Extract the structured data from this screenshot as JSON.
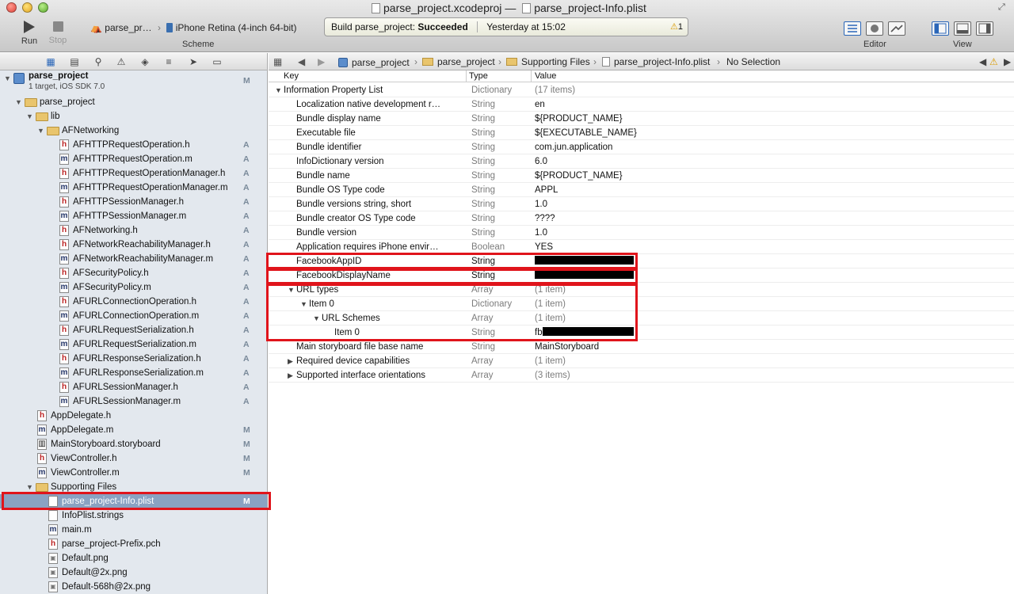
{
  "window": {
    "title": "parse_project.xcodeproj",
    "separator": "—",
    "document": "parse_project-Info.plist"
  },
  "toolbar": {
    "run_label": "Run",
    "stop_label": "Stop",
    "scheme_target": "parse_pr…",
    "scheme_device": "iPhone Retina (4-inch 64-bit)",
    "scheme_label": "Scheme",
    "activity_prefix": "Build parse_project:",
    "activity_status": "Succeeded",
    "activity_time": "Yesterday at 15:02",
    "warning_count": "1",
    "editor_label": "Editor",
    "view_label": "View"
  },
  "navigator": {
    "project": {
      "name": "parse_project",
      "subtitle": "1 target, iOS SDK 7.0",
      "badge": "M"
    },
    "rows": [
      {
        "label": "parse_project",
        "kind": "folder",
        "indent": 1,
        "open": true,
        "badge": ""
      },
      {
        "label": "lib",
        "kind": "folder",
        "indent": 2,
        "open": true,
        "badge": ""
      },
      {
        "label": "AFNetworking",
        "kind": "folder",
        "indent": 3,
        "open": true,
        "badge": ""
      },
      {
        "label": "AFHTTPRequestOperation.h",
        "kind": "h",
        "indent": 4,
        "badge": "A"
      },
      {
        "label": "AFHTTPRequestOperation.m",
        "kind": "m",
        "indent": 4,
        "badge": "A"
      },
      {
        "label": "AFHTTPRequestOperationManager.h",
        "kind": "h",
        "indent": 4,
        "badge": "A"
      },
      {
        "label": "AFHTTPRequestOperationManager.m",
        "kind": "m",
        "indent": 4,
        "badge": "A"
      },
      {
        "label": "AFHTTPSessionManager.h",
        "kind": "h",
        "indent": 4,
        "badge": "A"
      },
      {
        "label": "AFHTTPSessionManager.m",
        "kind": "m",
        "indent": 4,
        "badge": "A"
      },
      {
        "label": "AFNetworking.h",
        "kind": "h",
        "indent": 4,
        "badge": "A"
      },
      {
        "label": "AFNetworkReachabilityManager.h",
        "kind": "h",
        "indent": 4,
        "badge": "A"
      },
      {
        "label": "AFNetworkReachabilityManager.m",
        "kind": "m",
        "indent": 4,
        "badge": "A"
      },
      {
        "label": "AFSecurityPolicy.h",
        "kind": "h",
        "indent": 4,
        "badge": "A"
      },
      {
        "label": "AFSecurityPolicy.m",
        "kind": "m",
        "indent": 4,
        "badge": "A"
      },
      {
        "label": "AFURLConnectionOperation.h",
        "kind": "h",
        "indent": 4,
        "badge": "A"
      },
      {
        "label": "AFURLConnectionOperation.m",
        "kind": "m",
        "indent": 4,
        "badge": "A"
      },
      {
        "label": "AFURLRequestSerialization.h",
        "kind": "h",
        "indent": 4,
        "badge": "A"
      },
      {
        "label": "AFURLRequestSerialization.m",
        "kind": "m",
        "indent": 4,
        "badge": "A"
      },
      {
        "label": "AFURLResponseSerialization.h",
        "kind": "h",
        "indent": 4,
        "badge": "A"
      },
      {
        "label": "AFURLResponseSerialization.m",
        "kind": "m",
        "indent": 4,
        "badge": "A"
      },
      {
        "label": "AFURLSessionManager.h",
        "kind": "h",
        "indent": 4,
        "badge": "A"
      },
      {
        "label": "AFURLSessionManager.m",
        "kind": "m",
        "indent": 4,
        "badge": "A"
      },
      {
        "label": "AppDelegate.h",
        "kind": "h",
        "indent": 2,
        "badge": ""
      },
      {
        "label": "AppDelegate.m",
        "kind": "m",
        "indent": 2,
        "badge": "M"
      },
      {
        "label": "MainStoryboard.storyboard",
        "kind": "storyboard",
        "indent": 2,
        "badge": "M"
      },
      {
        "label": "ViewController.h",
        "kind": "h",
        "indent": 2,
        "badge": "M"
      },
      {
        "label": "ViewController.m",
        "kind": "m",
        "indent": 2,
        "badge": "M"
      },
      {
        "label": "Supporting Files",
        "kind": "folder",
        "indent": 2,
        "open": true,
        "badge": ""
      },
      {
        "label": "parse_project-Info.plist",
        "kind": "plist",
        "indent": 3,
        "badge": "M",
        "selected": true
      },
      {
        "label": "InfoPlist.strings",
        "kind": "strings",
        "indent": 3,
        "badge": ""
      },
      {
        "label": "main.m",
        "kind": "m",
        "indent": 3,
        "badge": ""
      },
      {
        "label": "parse_project-Prefix.pch",
        "kind": "h",
        "indent": 3,
        "badge": ""
      },
      {
        "label": "Default.png",
        "kind": "png",
        "indent": 3,
        "badge": ""
      },
      {
        "label": "Default@2x.png",
        "kind": "png",
        "indent": 3,
        "badge": ""
      },
      {
        "label": "Default-568h@2x.png",
        "kind": "png",
        "indent": 3,
        "badge": ""
      }
    ]
  },
  "jumpbar": {
    "crumbs": [
      "parse_project",
      "parse_project",
      "Supporting Files",
      "parse_project-Info.plist",
      "No Selection"
    ]
  },
  "plist": {
    "headers": {
      "key": "Key",
      "type": "Type",
      "value": "Value"
    },
    "rows": [
      {
        "key": "Information Property List",
        "type": "Dictionary",
        "value": "(17 items)",
        "depth": 0,
        "disc": "open",
        "dim": true
      },
      {
        "key": "Localization native development r…",
        "type": "String",
        "value": "en",
        "depth": 1
      },
      {
        "key": "Bundle display name",
        "type": "String",
        "value": "${PRODUCT_NAME}",
        "depth": 1
      },
      {
        "key": "Executable file",
        "type": "String",
        "value": "${EXECUTABLE_NAME}",
        "depth": 1
      },
      {
        "key": "Bundle identifier",
        "type": "String",
        "value": "com.jun.application",
        "depth": 1
      },
      {
        "key": "InfoDictionary version",
        "type": "String",
        "value": "6.0",
        "depth": 1
      },
      {
        "key": "Bundle name",
        "type": "String",
        "value": "${PRODUCT_NAME}",
        "depth": 1
      },
      {
        "key": "Bundle OS Type code",
        "type": "String",
        "value": "APPL",
        "depth": 1
      },
      {
        "key": "Bundle versions string, short",
        "type": "String",
        "value": "1.0",
        "depth": 1
      },
      {
        "key": "Bundle creator OS Type code",
        "type": "String",
        "value": "????",
        "depth": 1
      },
      {
        "key": "Bundle version",
        "type": "String",
        "value": "1.0",
        "depth": 1
      },
      {
        "key": "Application requires iPhone envir…",
        "type": "Boolean",
        "value": "YES",
        "depth": 1
      },
      {
        "key": "FacebookAppID",
        "type": "String",
        "value": "",
        "depth": 1,
        "redact": 125,
        "dark": true
      },
      {
        "key": "FacebookDisplayName",
        "type": "String",
        "value": "",
        "depth": 1,
        "redact": 125,
        "dark": true
      },
      {
        "key": "URL types",
        "type": "Array",
        "value": "(1 item)",
        "depth": 1,
        "disc": "open",
        "dim": true
      },
      {
        "key": "Item 0",
        "type": "Dictionary",
        "value": "(1 item)",
        "depth": 2,
        "disc": "open",
        "dim": true
      },
      {
        "key": "URL Schemes",
        "type": "Array",
        "value": "(1 item)",
        "depth": 3,
        "disc": "open",
        "dim": true
      },
      {
        "key": "Item 0",
        "type": "String",
        "value": "fb",
        "depth": 4,
        "redact": 115
      },
      {
        "key": "Main storyboard file base name",
        "type": "String",
        "value": "MainStoryboard",
        "depth": 1
      },
      {
        "key": "Required device capabilities",
        "type": "Array",
        "value": "(1 item)",
        "depth": 1,
        "disc": "closed",
        "dim": true
      },
      {
        "key": "Supported interface orientations",
        "type": "Array",
        "value": "(3 items)",
        "depth": 1,
        "disc": "closed",
        "dim": true
      }
    ]
  },
  "colors": {
    "highlight": "#e0141b",
    "selection": "#8aa2c2",
    "sidebar": "#e3e8ee"
  }
}
